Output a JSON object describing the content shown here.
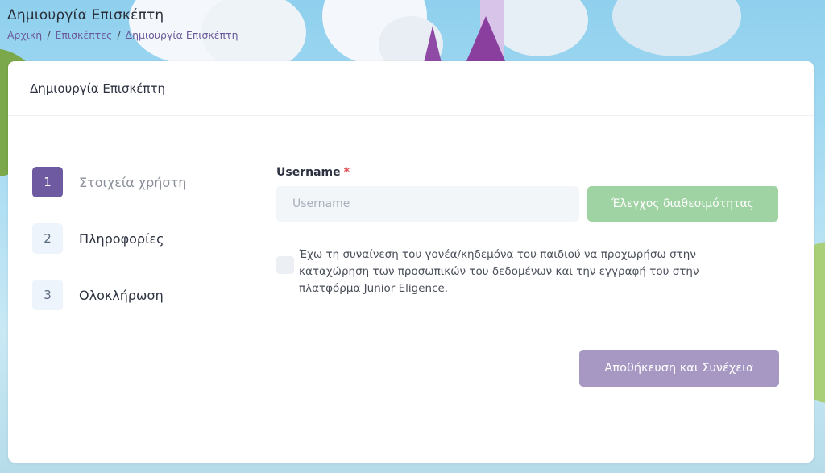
{
  "header": {
    "title": "Δημιουργία Επισκέπτη",
    "breadcrumb": [
      "Αρχική",
      "Επισκέπτες",
      "Δημιουργία Επισκέπτη"
    ],
    "separator": "/"
  },
  "card": {
    "title": "Δημιουργία Επισκέπτη"
  },
  "steps": [
    {
      "number": "1",
      "label": "Στοιχεία χρήστη",
      "active": true
    },
    {
      "number": "2",
      "label": "Πληροφορίες",
      "active": false
    },
    {
      "number": "3",
      "label": "Ολοκλήρωση",
      "active": false
    }
  ],
  "form": {
    "username_label": "Username",
    "required_mark": "*",
    "username_placeholder": "Username",
    "username_value": "",
    "check_button": "Έλεγχος διαθεσιμότητας",
    "consent_text": "Έχω τη συναίνεση του γονέα/κηδεμόνα του παιδιού να προχωρήσω στην καταχώρηση των προσωπικών του δεδομένων και την εγγραφή του στην πλατφόρμα Junior Eligence.",
    "consent_checked": false,
    "save_button": "Αποθήκευση και Συνέχεια"
  },
  "colors": {
    "accent": "#6d5aa0",
    "check_button": "#9fd3a3",
    "save_button": "#a698c3",
    "required": "#e0484c"
  }
}
